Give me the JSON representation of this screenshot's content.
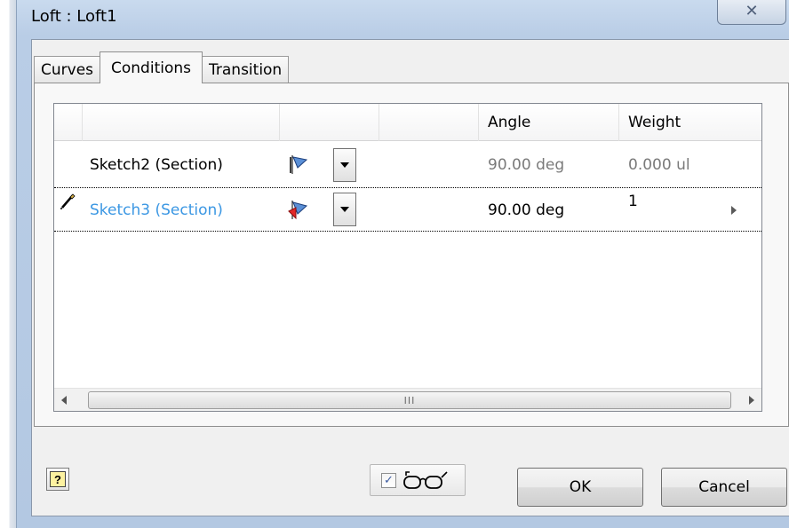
{
  "window": {
    "title": "Loft : Loft1",
    "close_glyph": "✕"
  },
  "tabs": [
    {
      "label": "Curves",
      "active": false
    },
    {
      "label": "Conditions",
      "active": true
    },
    {
      "label": "Transition",
      "active": false
    }
  ],
  "grid": {
    "headers": [
      "",
      "",
      "",
      "Angle",
      "Weight"
    ],
    "rows": [
      {
        "name": "Sketch2 (Section)",
        "angle": "90.00 deg",
        "weight": "0.000 ul",
        "selected": false,
        "name_color": "#000000",
        "value_color": "#7a7a7a"
      },
      {
        "name": "Sketch3 (Section)",
        "angle": "90.00 deg",
        "weight": "1",
        "selected": true,
        "name_color": "#3b97e3",
        "value_color": "#000000"
      }
    ],
    "scroll_grip": "III"
  },
  "footer": {
    "help_glyph": "?",
    "preview_checked": true,
    "ok_label": "OK",
    "cancel_label": "Cancel"
  },
  "colors": {
    "selected_text": "#3b97e3",
    "frame": "#b9cde6"
  }
}
